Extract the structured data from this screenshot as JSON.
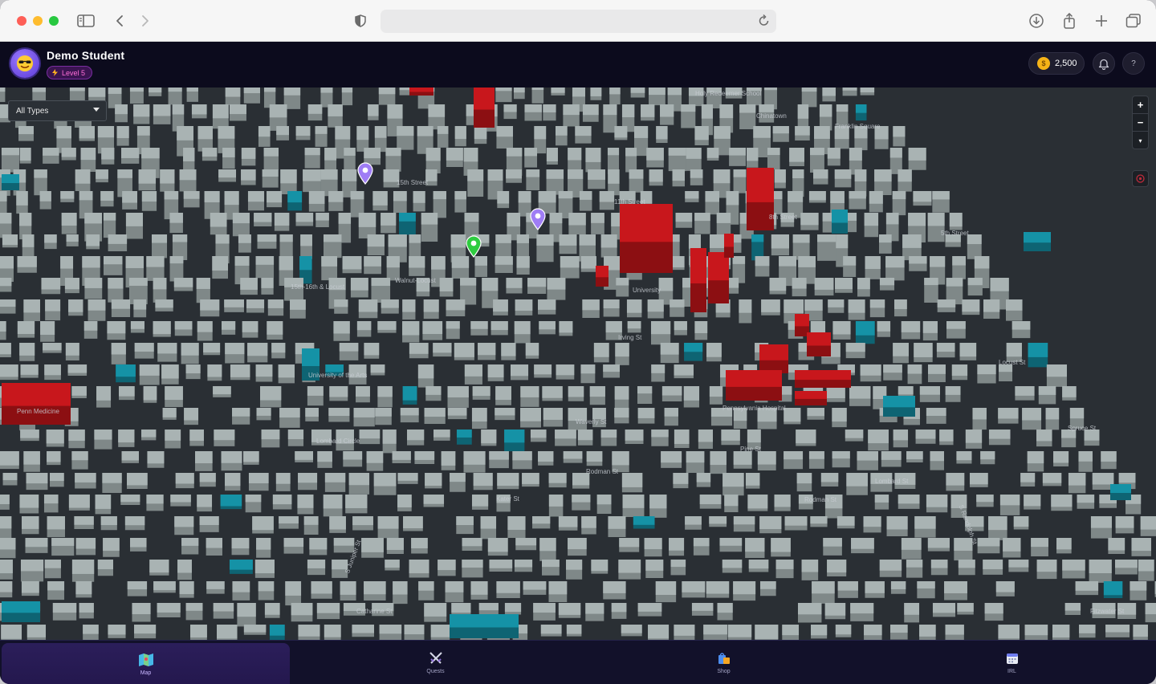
{
  "browser": {
    "address": ""
  },
  "header": {
    "username": "Demo Student",
    "level": "Level 5",
    "coins": "2,500",
    "help": "?"
  },
  "map": {
    "filter": {
      "selected": "All Types"
    },
    "zoom": {
      "in": "+",
      "out": "−",
      "compass": "▾"
    },
    "labels": [
      "Chinatown",
      "Franklin Square",
      "15th Street",
      "11th Street",
      "8th Street",
      "5th Street",
      "15th-16th & Locust",
      "Walnut-Locust",
      "Irving St",
      "Locust St",
      "University of the Arts",
      "Penn Medicine",
      "Pennsylvania Hospital",
      "Waverly St",
      "Lombard Circle",
      "Rodman St",
      "Kater St",
      "Lombard St",
      "Rodman St",
      "S Juniper St",
      "S Randolph St",
      "Catharine St",
      "Pine St",
      "Spruce St",
      "Fitzwater St",
      "Holy Redeemer School",
      "University"
    ],
    "accent_red": "#c8171c",
    "accent_teal": "#1592a6",
    "building_color": "#a9b3b3"
  },
  "nav": {
    "items": [
      {
        "label": "Map",
        "icon": "map-icon",
        "active": true
      },
      {
        "label": "Quests",
        "icon": "swords-icon",
        "active": false
      },
      {
        "label": "Shop",
        "icon": "shopping-bag-icon",
        "active": false
      },
      {
        "label": "IRL",
        "icon": "calendar-icon",
        "active": false
      }
    ]
  }
}
